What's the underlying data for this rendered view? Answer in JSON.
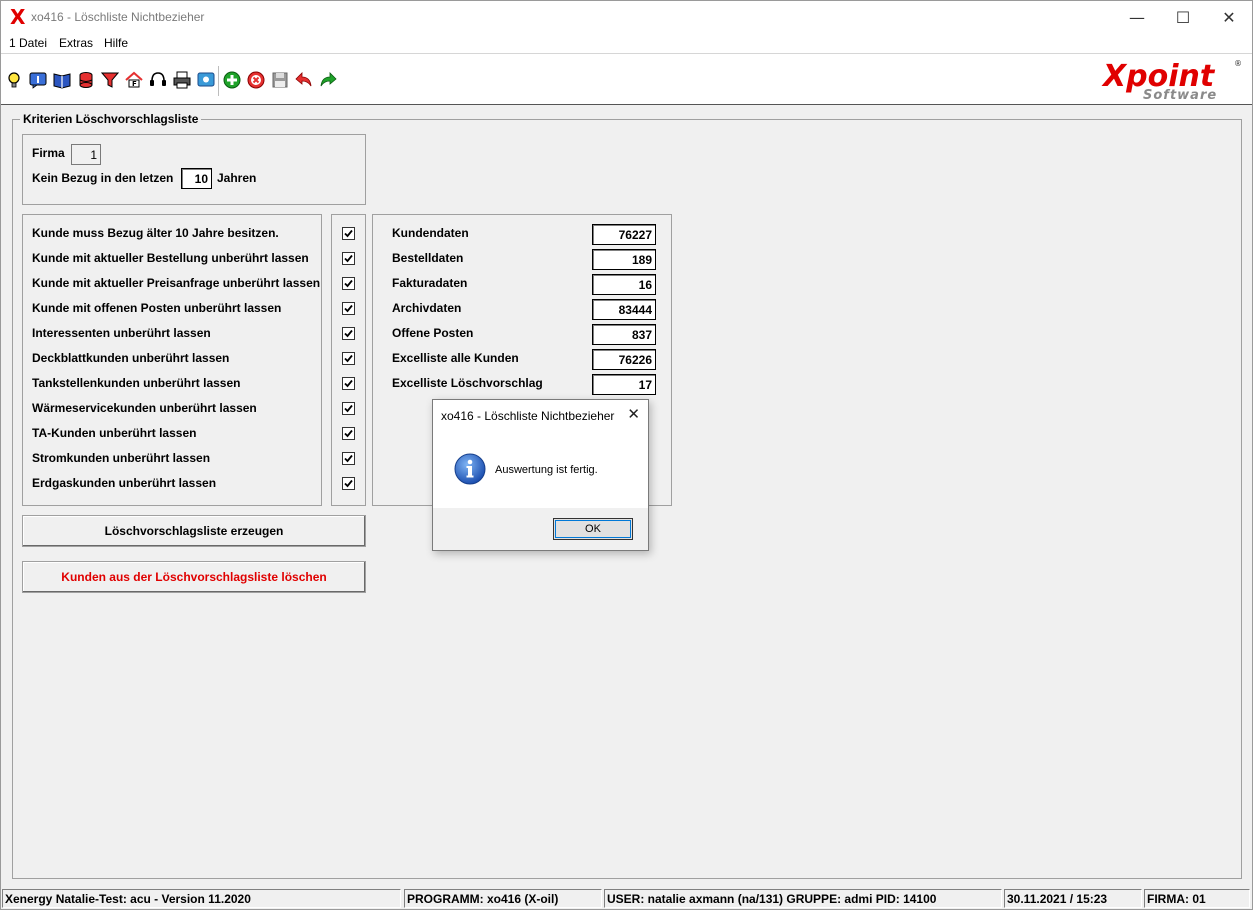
{
  "window": {
    "title": "xo416 - Löschliste Nichtbezieher",
    "app_icon_glyph": "X",
    "minimize_glyph": "—",
    "maximize_glyph": "☐",
    "close_glyph": "✕"
  },
  "menu": [
    "1 Datei",
    "Extras",
    "Hilfe"
  ],
  "toolbar": {
    "icons": [
      "lightbulb-icon",
      "info-icon",
      "book-icon",
      "database-icon",
      "filter-icon",
      "home-icon",
      "headset-icon",
      "printer-icon",
      "monitor-icon",
      "add-icon",
      "cancel-icon",
      "save-icon",
      "undo-icon",
      "redo-icon"
    ]
  },
  "logo": {
    "main": "Xpoint",
    "sub": "Software",
    "mark": "®"
  },
  "group": {
    "title": "Kriterien Löschvorschlagsliste"
  },
  "criteria": {
    "firma_label": "Firma",
    "firma_value": "1",
    "kein_bezug_label": "Kein Bezug in den letzen",
    "jahre_value": "10",
    "jahren_label": "Jahren"
  },
  "options": [
    {
      "label": "Kunde muss Bezug älter 10 Jahre besitzen.",
      "checked": true
    },
    {
      "label": "Kunde mit aktueller Bestellung unberührt lassen",
      "checked": true
    },
    {
      "label": "Kunde mit aktueller Preisanfrage unberührt lassen",
      "checked": true
    },
    {
      "label": "Kunde mit offenen Posten unberührt lassen",
      "checked": true
    },
    {
      "label": "Interessenten unberührt lassen",
      "checked": true
    },
    {
      "label": "Deckblattkunden unberührt lassen",
      "checked": true
    },
    {
      "label": "Tankstellenkunden unberührt lassen",
      "checked": true
    },
    {
      "label": "Wärmeservicekunden unberührt lassen",
      "checked": true
    },
    {
      "label": "TA-Kunden unberührt lassen",
      "checked": true
    },
    {
      "label": "Stromkunden unberührt lassen",
      "checked": true
    },
    {
      "label": "Erdgaskunden unberührt lassen",
      "checked": true
    }
  ],
  "counts": [
    {
      "label": "Kundendaten",
      "value": "76227"
    },
    {
      "label": "Bestelldaten",
      "value": "189"
    },
    {
      "label": "Fakturadaten",
      "value": "16"
    },
    {
      "label": "Archivdaten",
      "value": "83444"
    },
    {
      "label": "Offene Posten",
      "value": "837"
    },
    {
      "label": "Excelliste alle Kunden",
      "value": "76226"
    },
    {
      "label": "Excelliste Löschvorschlag",
      "value": "17"
    }
  ],
  "buttons": {
    "create": "Löschvorschlagsliste erzeugen",
    "delete": "Kunden aus der Löschvorschlagsliste löschen",
    "delete_color": "#e00000"
  },
  "dialog": {
    "title": "xo416 - Löschliste Nichtbezieher",
    "message": "Auswertung ist fertig.",
    "ok": "OK",
    "close_glyph": "✕",
    "icon": "info-icon"
  },
  "status": {
    "system": "Xenergy Natalie-Test: acu - Version 11.2020",
    "program": "PROGRAMM: xo416 (X-oil)",
    "user": "USER: natalie axmann (na/131)  GRUPPE: admi  PID: 14100",
    "datetime": "30.11.2021 / 15:23",
    "firma": "FIRMA: 01"
  }
}
